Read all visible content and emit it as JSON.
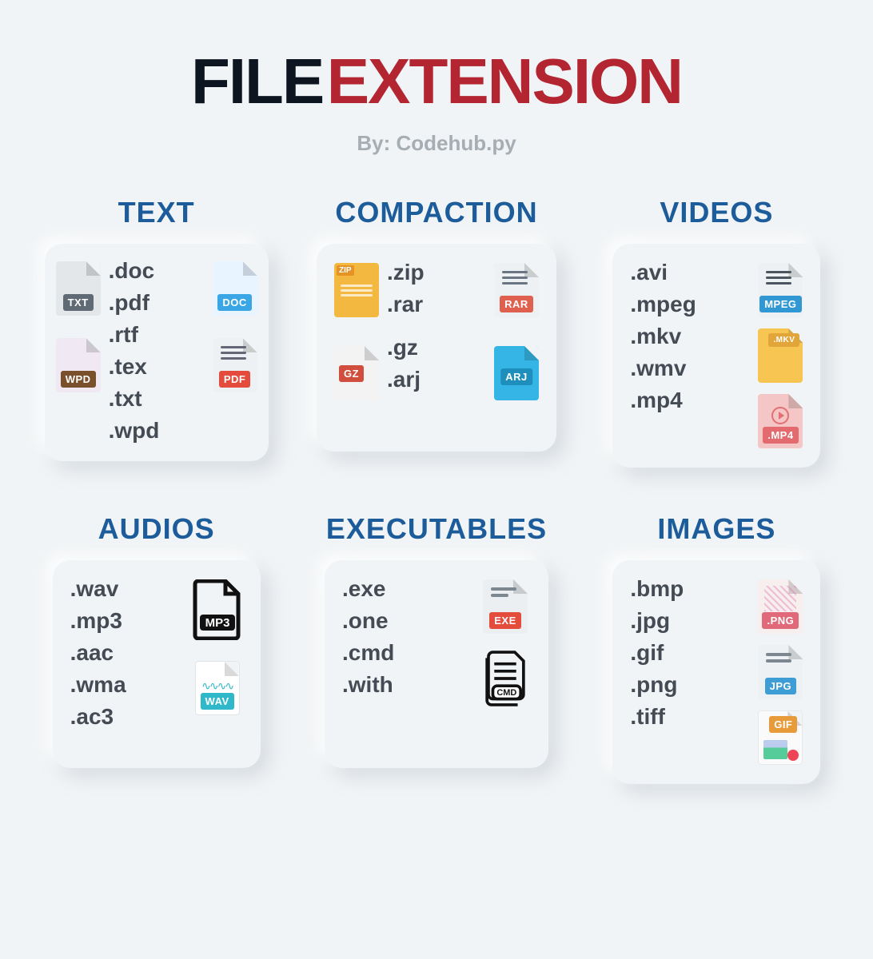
{
  "title": {
    "word1": "FILE",
    "word2": "EXTENSION"
  },
  "byline": "By: Codehub.py",
  "categories": [
    {
      "key": "text",
      "title": "TEXT",
      "ext": [
        ".doc",
        ".pdf",
        ".rtf",
        ".tex",
        ".txt",
        ".wpd"
      ],
      "icons_left": [
        "TXT",
        "WPD"
      ],
      "icons_right": [
        "DOC",
        "PDF"
      ]
    },
    {
      "key": "compaction",
      "title": "COMPACTION",
      "ext": [
        ".zip",
        ".rar",
        ".gz",
        ".arj"
      ],
      "icons_left": [
        "ZIP",
        "GZ"
      ],
      "icons_right": [
        "RAR",
        "ARJ"
      ]
    },
    {
      "key": "videos",
      "title": "VIDEOS",
      "ext": [
        ".avi",
        ".mpeg",
        ".mkv",
        ".wmv",
        ".mp4"
      ],
      "icons_right": [
        "MPEG",
        "MKV",
        "MP4"
      ]
    },
    {
      "key": "audios",
      "title": "AUDIOS",
      "ext": [
        ".wav",
        ".mp3",
        ".aac",
        ".wma",
        ".ac3"
      ],
      "icons_right": [
        "MP3",
        "WAV"
      ]
    },
    {
      "key": "executables",
      "title": "EXECUTABLES",
      "ext": [
        ".exe",
        ".one",
        ".cmd",
        ".with"
      ],
      "icons_right": [
        "EXE",
        "CMD"
      ]
    },
    {
      "key": "images",
      "title": "IMAGES",
      "ext": [
        ".bmp",
        ".jpg",
        ".gif",
        ".png",
        ".tiff"
      ],
      "icons_right": [
        "PNG",
        "JPG",
        "GIF"
      ]
    }
  ],
  "icon_badges": {
    "TXT": "TXT",
    "DOC": "DOC",
    "WPD": "WPD",
    "PDF": "PDF",
    "ZIP": "ZIP",
    "RAR": "RAR",
    "GZ": "GZ",
    "ARJ": "ARJ",
    "MPEG": "MPEG",
    "MKV": ".MKV",
    "MP4": ".MP4",
    "MP3": "MP3",
    "WAV": "WAV",
    "EXE": "EXE",
    "CMD": "CMD",
    "PNG": ".PNG",
    "JPG": "JPG",
    "GIF": "GIF"
  }
}
